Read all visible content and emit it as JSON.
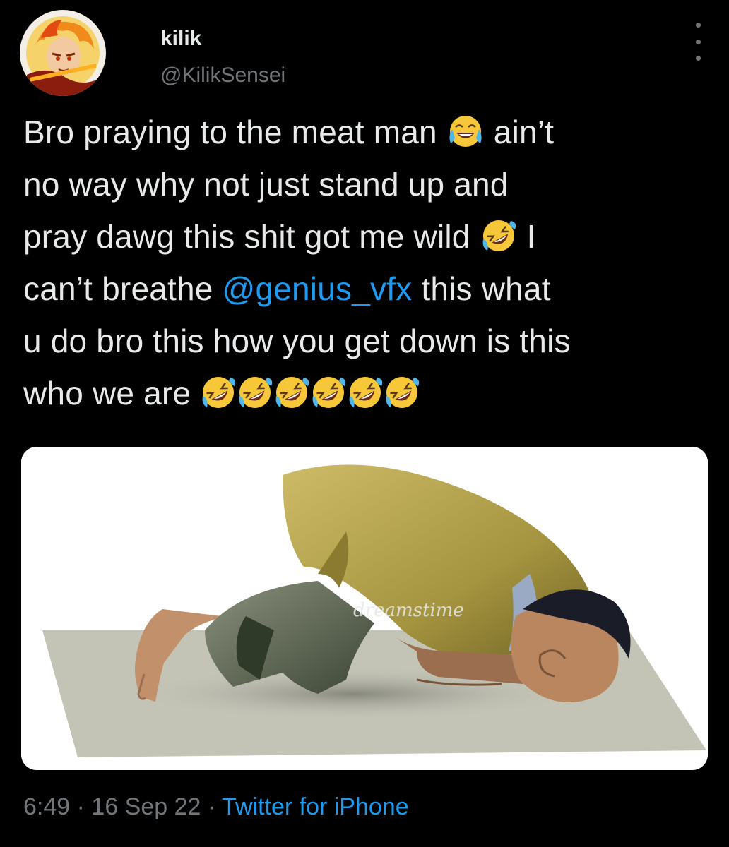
{
  "tweet": {
    "author": {
      "display_name": "kilik",
      "handle": "@KilikSensei",
      "avatar": "anime-character-avatar"
    },
    "text": {
      "line1_a": "Bro praying to the meat man",
      "line1_emoji": "face-with-tears-of-joy",
      "line1_b": "ain’t",
      "line2": "no way why not just stand up and",
      "line3_a": "pray dawg this shit got me wild",
      "line3_emoji": "rolling-on-the-floor-laughing",
      "line3_b": "I",
      "line4_a": "can’t breathe",
      "mention": "@genius_vfx",
      "line4_b": "this what",
      "line5": "u do bro this how you get down is this",
      "line6_a": "who we are",
      "line6_emoji_count": 6,
      "line6_emoji": "rolling-on-the-floor-laughing"
    },
    "media": {
      "watermark": "dreamstime"
    },
    "meta": {
      "time": "6:49",
      "separator1": " · ",
      "date": "16 Sep 22",
      "separator2": " · ",
      "source": "Twitter for iPhone"
    }
  },
  "colors": {
    "background": "#000000",
    "text": "#e7e9ea",
    "secondary": "#71767b",
    "link": "#1d9bf0"
  }
}
